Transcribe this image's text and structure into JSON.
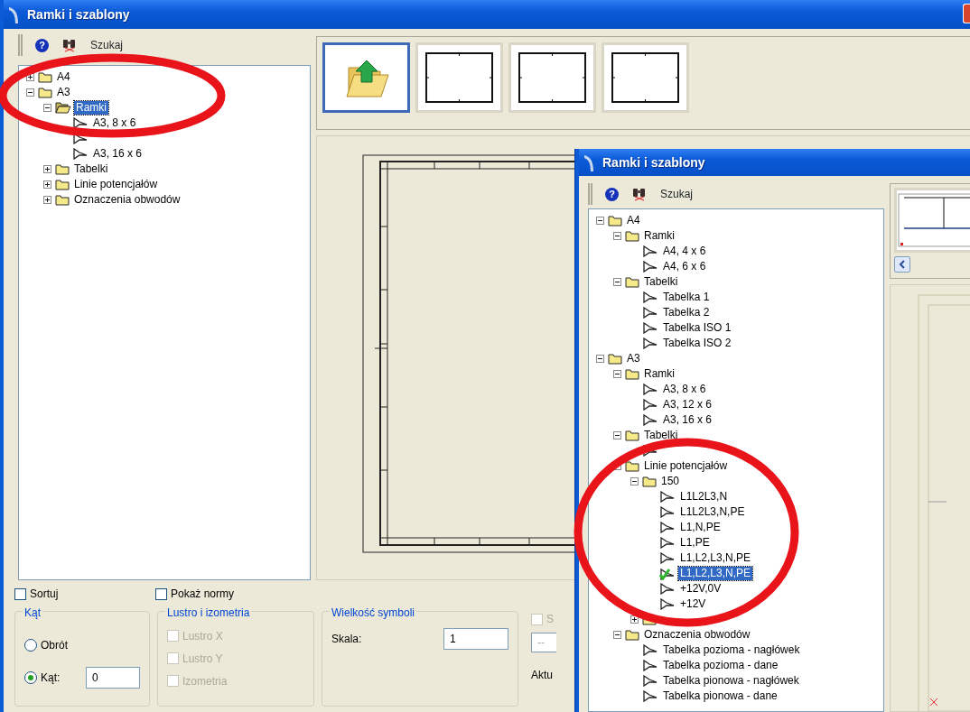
{
  "windows": [
    {
      "title": "Ramki i szablony",
      "toolbar": {
        "help_glyph": "?",
        "search_label": "Szukaj"
      },
      "tree": [
        {
          "kind": "folder",
          "label": "A4",
          "expanded": false,
          "selected": false
        },
        {
          "kind": "folder",
          "label": "A3",
          "expanded": true,
          "selected": false,
          "children": [
            {
              "kind": "folder",
              "label": "Ramki",
              "expanded": true,
              "selected": true,
              "children": [
                {
                  "kind": "item",
                  "label": "A3, 8 x 6",
                  "selected": false
                },
                {
                  "kind": "item",
                  "selected": false
                },
                {
                  "kind": "item",
                  "label": "A3, 16 x 6",
                  "selected": false
                }
              ]
            },
            {
              "kind": "folder",
              "label": "Tabelki",
              "expanded": false,
              "selected": false
            },
            {
              "kind": "folder",
              "label": "Linie potencjałów",
              "expanded": false,
              "selected": false
            },
            {
              "kind": "folder",
              "label": "Oznaczenia obwodów",
              "expanded": false,
              "selected": false
            }
          ]
        }
      ],
      "thumbnails": [
        {
          "kind": "open",
          "selected": true
        },
        {
          "kind": "sheet",
          "selected": false
        },
        {
          "kind": "sheet",
          "selected": false
        },
        {
          "kind": "sheet",
          "selected": false
        }
      ],
      "options": {
        "checkboxes": [
          {
            "label": "Sortuj",
            "checked": false
          },
          {
            "label": "Pokaż normy",
            "checked": false
          }
        ],
        "groups": [
          {
            "kind": "angle",
            "title": "Kąt",
            "radios": [
              {
                "label": "Obrót",
                "selected": false
              },
              {
                "label": "Kąt:",
                "selected": true
              }
            ],
            "value": "0"
          },
          {
            "kind": "mirror",
            "title": "Lustro i izometria",
            "checkboxes": [
              {
                "label": "Lustro X",
                "checked": false,
                "disabled": true
              },
              {
                "label": "Lustro Y",
                "checked": false,
                "disabled": true
              },
              {
                "label": "Izometria",
                "checked": false,
                "disabled": true
              }
            ]
          },
          {
            "kind": "scale",
            "title": "Wielkość symboli",
            "field_label": "Skala:",
            "value": "1"
          }
        ],
        "partial": {
          "checkbox_label": "S",
          "checkbox_disabled": true,
          "select_value": "--",
          "label": "Aktu"
        }
      }
    },
    {
      "title": "Ramki i szablony",
      "toolbar": {
        "help_glyph": "?",
        "search_label": "Szukaj"
      },
      "tree": [
        {
          "kind": "folder",
          "label": "A4",
          "expanded": true,
          "selected": false,
          "children": [
            {
              "kind": "folder",
              "label": "Ramki",
              "expanded": true,
              "selected": false,
              "children": [
                {
                  "kind": "item",
                  "label": "A4, 4 x 6",
                  "selected": false
                },
                {
                  "kind": "item",
                  "label": "A4, 6 x 6",
                  "selected": false
                }
              ]
            },
            {
              "kind": "folder",
              "label": "Tabelki",
              "expanded": true,
              "selected": false,
              "children": [
                {
                  "kind": "item",
                  "label": "Tabelka 1",
                  "selected": false
                },
                {
                  "kind": "item",
                  "label": "Tabelka 2",
                  "selected": false
                },
                {
                  "kind": "item",
                  "label": "Tabelka ISO 1",
                  "selected": false
                },
                {
                  "kind": "item",
                  "label": "Tabelka ISO 2",
                  "selected": false
                }
              ]
            }
          ]
        },
        {
          "kind": "folder",
          "label": "A3",
          "expanded": true,
          "selected": false,
          "children": [
            {
              "kind": "folder",
              "label": "Ramki",
              "expanded": true,
              "selected": false,
              "children": [
                {
                  "kind": "item",
                  "label": "A3, 8 x 6",
                  "selected": false
                },
                {
                  "kind": "item",
                  "label": "A3, 12 x 6",
                  "selected": false
                },
                {
                  "kind": "item",
                  "label": "A3, 16 x 6",
                  "selected": false
                }
              ]
            },
            {
              "kind": "folder",
              "label": "Tabelki",
              "expanded": true,
              "selected": false,
              "children": [
                {
                  "kind": "item",
                  "selected": false
                }
              ]
            },
            {
              "kind": "folder",
              "label": "Linie potencjałów",
              "expanded": true,
              "selected": false,
              "children": [
                {
                  "kind": "folder",
                  "label": "150",
                  "expanded": true,
                  "selected": false,
                  "children": [
                    {
                      "kind": "item",
                      "label": "L1L2L3,N",
                      "selected": false
                    },
                    {
                      "kind": "item",
                      "label": "L1L2L3,N,PE",
                      "selected": false
                    },
                    {
                      "kind": "item",
                      "label": "L1,N,PE",
                      "selected": false
                    },
                    {
                      "kind": "item",
                      "label": "L1,PE",
                      "selected": false
                    },
                    {
                      "kind": "item",
                      "label": "L1,L2,L3,N,PE",
                      "selected": false
                    },
                    {
                      "kind": "active-item",
                      "label": "L1,L2,L3,N,PE",
                      "selected": true
                    },
                    {
                      "kind": "item",
                      "label": "+12V,0V",
                      "selected": false
                    },
                    {
                      "kind": "item",
                      "label": "+12V",
                      "selected": false
                    }
                  ]
                },
                {
                  "kind": "folder",
                  "expanded": false,
                  "selected": false
                }
              ]
            },
            {
              "kind": "folder",
              "label": "Oznaczenia obwodów",
              "expanded": true,
              "selected": false,
              "children": [
                {
                  "kind": "item",
                  "label": "Tabelka pozioma - nagłówek",
                  "selected": false
                },
                {
                  "kind": "item",
                  "label": "Tabelka pozioma - dane",
                  "selected": false
                },
                {
                  "kind": "item",
                  "label": "Tabelka pionowa - nagłówek",
                  "selected": false
                },
                {
                  "kind": "item",
                  "label": "Tabelka pionowa - dane",
                  "selected": false
                }
              ]
            }
          ]
        }
      ],
      "thumbnails": [
        {
          "kind": "sheet-preview",
          "selected": false
        }
      ]
    }
  ]
}
